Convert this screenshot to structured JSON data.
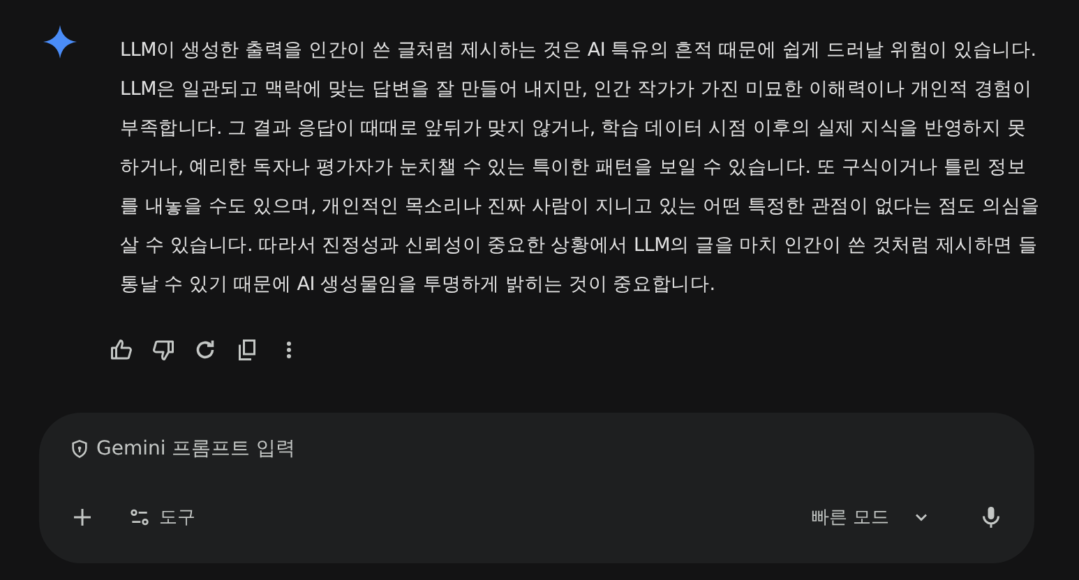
{
  "response": {
    "text": "LLM이 생성한 출력을 인간이 쓴 글처럼 제시하는 것은 AI 특유의 흔적 때문에 쉽게 드러날 위험이 있습니다. LLM은 일관되고 맥락에 맞는 답변을 잘 만들어 내지만, 인간 작가가 가진 미묘한 이해력이나 개인적 경험이 부족합니다. 그 결과 응답이 때때로 앞뒤가 맞지 않거나, 학습 데이터 시점 이후의 실제 지식을 반영하지 못하거나, 예리한 독자나 평가자가 눈치챌 수 있는 특이한 패턴을 보일 수 있습니다. 또 구식이거나 틀린 정보를 내놓을 수도 있으며, 개인적인 목소리나 진짜 사람이 지니고 있는 어떤 특정한 관점이 없다는 점도 의심을 살 수 있습니다. 따라서 진정성과 신뢰성이 중요한 상황에서 LLM의 글을 마치 인간이 쓴 것처럼 제시하면 들통날 수 있기 때문에 AI 생성물임을 투명하게 밝히는 것이 중요합니다."
  },
  "prompt": {
    "placeholder": "Gemini 프롬프트 입력",
    "tools_label": "도구",
    "mode_label": "빠른 모드"
  }
}
